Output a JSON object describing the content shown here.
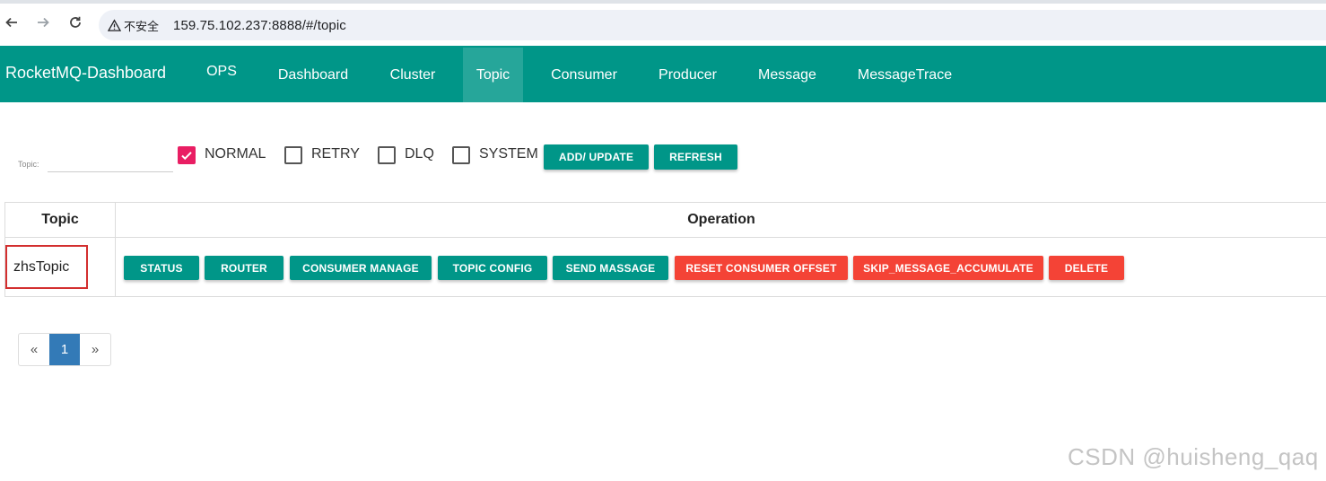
{
  "browser": {
    "security_label": "不安全",
    "url": "159.75.102.237:8888/#/topic"
  },
  "nav": {
    "brand": "RocketMQ-Dashboard",
    "items": [
      "OPS",
      "Dashboard",
      "Cluster",
      "Topic",
      "Consumer",
      "Producer",
      "Message",
      "MessageTrace"
    ],
    "active": "Topic"
  },
  "toolbar": {
    "topic_label": "Topic:",
    "topic_value": "",
    "filters": [
      {
        "label": "NORMAL",
        "checked": true
      },
      {
        "label": "RETRY",
        "checked": false
      },
      {
        "label": "DLQ",
        "checked": false
      },
      {
        "label": "SYSTEM",
        "checked": false
      }
    ],
    "add_update": "ADD/ UPDATE",
    "refresh": "REFRESH"
  },
  "table": {
    "headers": [
      "Topic",
      "Operation"
    ],
    "rows": [
      {
        "topic": "zhsTopic",
        "operations": [
          "STATUS",
          "ROUTER",
          "CONSUMER MANAGE",
          "TOPIC CONFIG",
          "SEND MASSAGE",
          "RESET CONSUMER OFFSET",
          "SKIP_MESSAGE_ACCUMULATE",
          "DELETE"
        ]
      }
    ]
  },
  "pagination": {
    "prev": "«",
    "pages": [
      "1"
    ],
    "current": "1",
    "next": "»"
  },
  "colors": {
    "primary": "#009688",
    "active_nav": "#26a69a",
    "danger": "#f44336",
    "checkbox": "#e91e63",
    "page_active": "#337ab7"
  },
  "watermark": "CSDN @huisheng_qaq"
}
